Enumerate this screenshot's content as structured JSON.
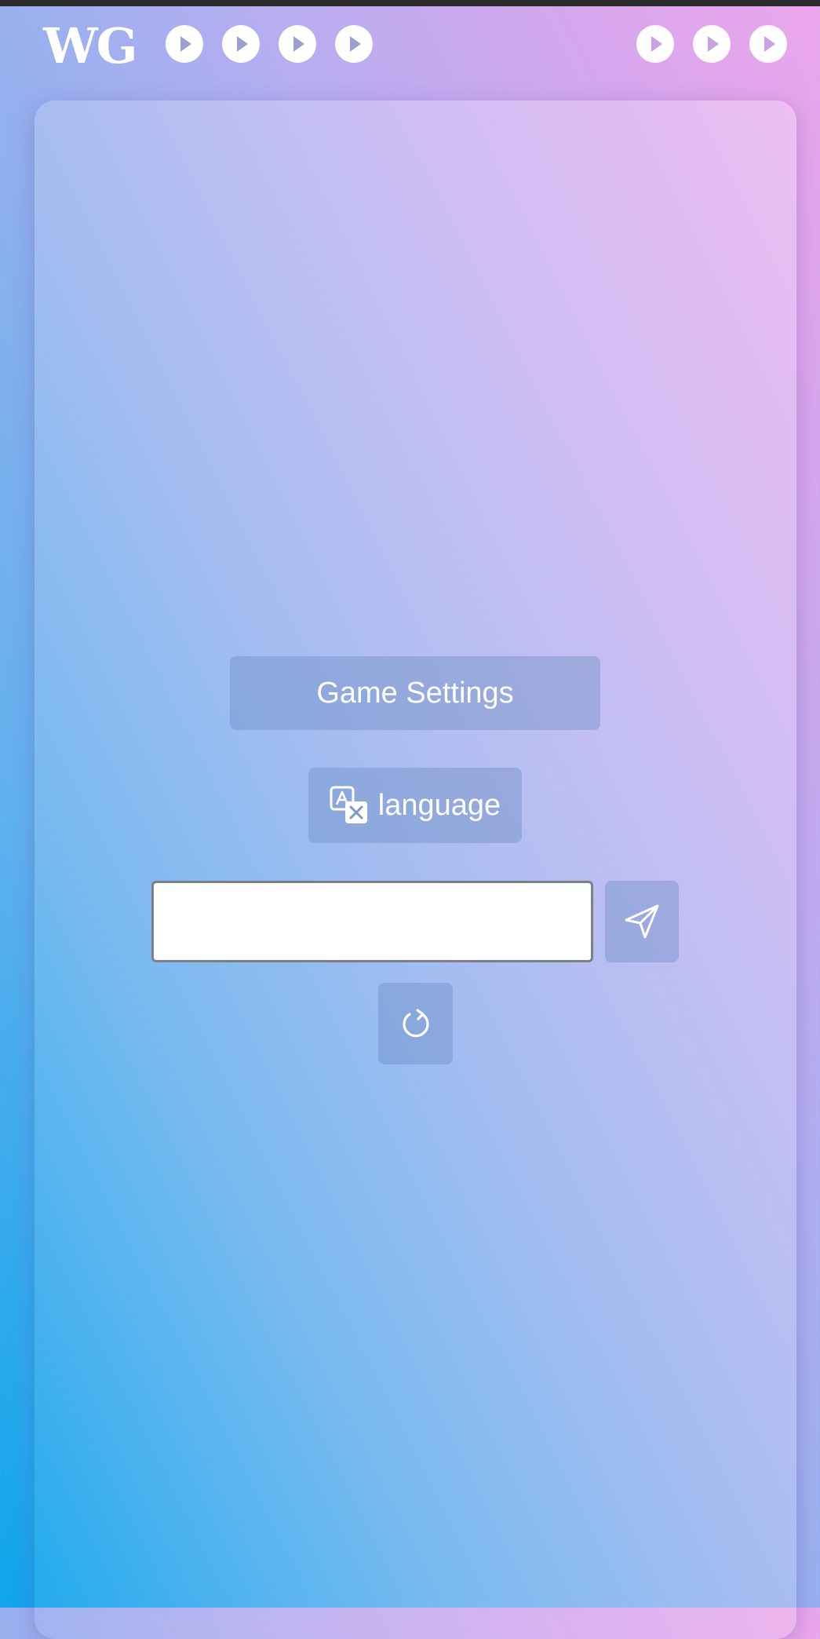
{
  "header": {
    "logo_text": "WG",
    "left_play_buttons": [
      "play-icon",
      "play-icon",
      "play-icon",
      "play-icon"
    ],
    "right_play_buttons": [
      "play-icon",
      "play-icon",
      "play-icon"
    ]
  },
  "main": {
    "game_settings_label": "Game Settings",
    "language_label": "language",
    "language_icon": "translate-icon",
    "input": {
      "value": "",
      "placeholder": ""
    },
    "send_icon": "send-icon",
    "refresh_icon": "refresh-icon"
  },
  "colors": {
    "gradient_bottom_left": "#0ea5ec",
    "gradient_top_right": "#eca6ea",
    "button_background": "rgba(110,140,195,0.42)",
    "text": "#ffffff"
  }
}
